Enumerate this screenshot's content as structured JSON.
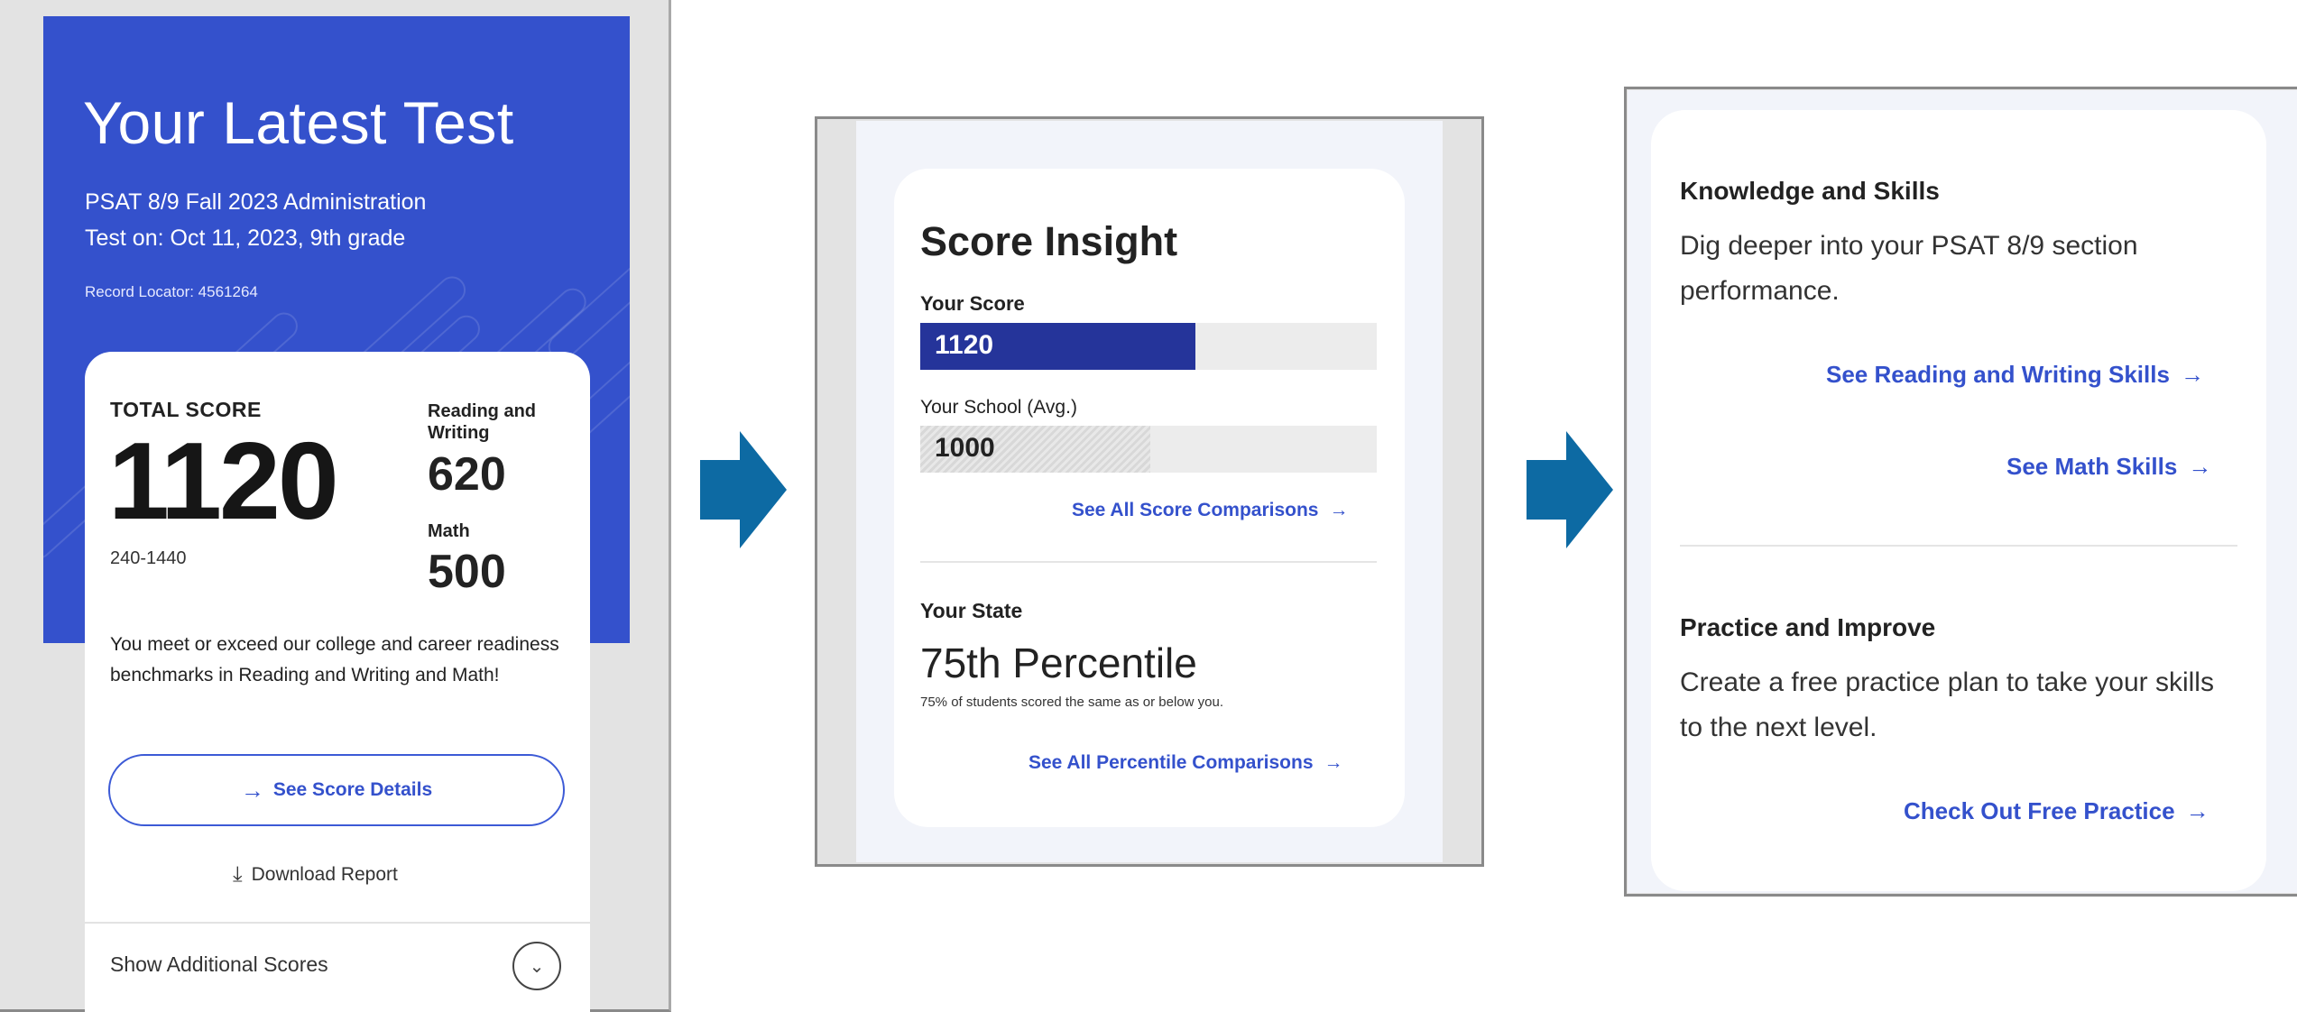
{
  "panel1": {
    "title": "Your Latest Test",
    "administration": "PSAT 8/9 Fall 2023 Administration",
    "test_date": "Test on: Oct 11, 2023, 9th grade",
    "record_locator": "Record Locator: 4561264",
    "total_score_label": "TOTAL SCORE",
    "total_score": "1120",
    "score_range": "240-1440",
    "rw_label": "Reading and Writing",
    "rw_score": "620",
    "math_label": "Math",
    "math_score": "500",
    "benchmark_message": "You meet or exceed our college and career readiness benchmarks in Reading and Writing and Math!",
    "see_details_label": "See Score Details",
    "download_label": "Download Report",
    "additional_scores_label": "Show Additional Scores",
    "accent_color": "#3451cc"
  },
  "panel2": {
    "title": "Score Insight",
    "your_score_label": "Your Score",
    "your_score_value": "1120",
    "school_label": "Your School (Avg.)",
    "school_value": "1000",
    "score_scale_max": 1600,
    "compare_link": "See All Score Comparisons",
    "state_label": "Your State",
    "percentile": "75th Percentile",
    "percentile_note": "75% of students scored the same as or below you.",
    "percentile_link": "See All Percentile Comparisons"
  },
  "panel3": {
    "knowledge_title": "Knowledge and Skills",
    "knowledge_desc": "Dig deeper into your PSAT 8/9 section performance.",
    "rw_skills_link": "See Reading and Writing Skills",
    "math_skills_link": "See Math Skills",
    "practice_title": "Practice and Improve",
    "practice_desc": "Create a free practice plan to take your skills to the next level.",
    "practice_link": "Check Out Free Practice"
  },
  "icons": {
    "arrow": "→",
    "chevron": "⌄",
    "download": "⤓"
  },
  "flow_arrow_color": "#0d6aa3"
}
